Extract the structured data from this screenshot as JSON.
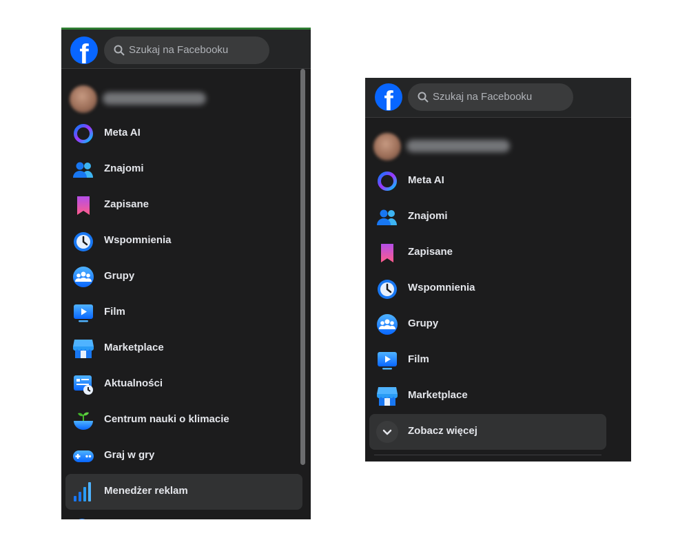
{
  "search": {
    "placeholder": "Szukaj na Facebooku"
  },
  "brand": {
    "logo_letter": "f",
    "accent": "#0866ff"
  },
  "profile": {
    "name_blurred": true
  },
  "left_panel": {
    "items": [
      {
        "label": "Meta AI",
        "icon": "meta-ai-icon"
      },
      {
        "label": "Znajomi",
        "icon": "friends-icon"
      },
      {
        "label": "Zapisane",
        "icon": "saved-icon"
      },
      {
        "label": "Wspomnienia",
        "icon": "memories-icon"
      },
      {
        "label": "Grupy",
        "icon": "groups-icon"
      },
      {
        "label": "Film",
        "icon": "video-icon"
      },
      {
        "label": "Marketplace",
        "icon": "marketplace-icon"
      },
      {
        "label": "Aktualności",
        "icon": "feeds-icon"
      },
      {
        "label": "Centrum nauki o klimacie",
        "icon": "climate-center-icon"
      },
      {
        "label": "Graj w gry",
        "icon": "gaming-icon"
      },
      {
        "label": "Menedżer reklam",
        "icon": "ads-manager-icon",
        "highlighted": true
      }
    ]
  },
  "right_panel": {
    "items": [
      {
        "label": "Meta AI",
        "icon": "meta-ai-icon"
      },
      {
        "label": "Znajomi",
        "icon": "friends-icon"
      },
      {
        "label": "Zapisane",
        "icon": "saved-icon"
      },
      {
        "label": "Wspomnienia",
        "icon": "memories-icon"
      },
      {
        "label": "Grupy",
        "icon": "groups-icon"
      },
      {
        "label": "Film",
        "icon": "video-icon"
      },
      {
        "label": "Marketplace",
        "icon": "marketplace-icon"
      }
    ],
    "see_more": {
      "label": "Zobacz więcej",
      "icon": "chevron-down-icon"
    }
  }
}
